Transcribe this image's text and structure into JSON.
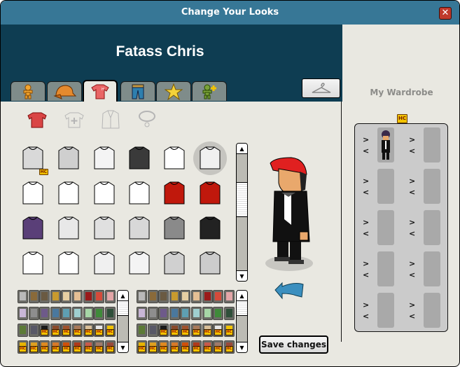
{
  "window": {
    "title": "Change Your Looks",
    "close_icon": "close-icon"
  },
  "header": {
    "username": "Fatass Chris"
  },
  "tabs": [
    {
      "name": "body",
      "icon": "body-figure-icon",
      "active": false
    },
    {
      "name": "head",
      "icon": "cap-icon",
      "active": false
    },
    {
      "name": "tops",
      "icon": "tshirt-icon",
      "active": true
    },
    {
      "name": "bottoms",
      "icon": "trousers-icon",
      "active": false
    },
    {
      "name": "extras",
      "icon": "star-icon",
      "active": false
    },
    {
      "name": "effects",
      "icon": "figure-plus-icon",
      "active": false
    }
  ],
  "wardrobe_button": {
    "icon": "hanger-icon"
  },
  "subcategories": [
    {
      "name": "shirts",
      "icon": "shirt-icon",
      "active": true
    },
    {
      "name": "prints",
      "icon": "shirt-print-icon",
      "active": false
    },
    {
      "name": "jackets",
      "icon": "jacket-icon",
      "active": false
    },
    {
      "name": "accessories",
      "icon": "necklace-icon",
      "active": false
    }
  ],
  "items": [
    {
      "id": "crop-top-stripe",
      "color": "#d9d9d9",
      "hc": true,
      "selected": false
    },
    {
      "id": "open-vest-gray",
      "color": "#cfcfcf",
      "hc": false,
      "selected": false
    },
    {
      "id": "button-blouse",
      "color": "#f4f4f4",
      "hc": false,
      "selected": false
    },
    {
      "id": "polka-dot-dress",
      "color": "#3a3a3a",
      "hc": false,
      "selected": false
    },
    {
      "id": "tank-ruffle",
      "color": "#ffffff",
      "hc": false,
      "selected": false
    },
    {
      "id": "tuxedo-shirt",
      "color": "#f0f0f0",
      "hc": false,
      "selected": true
    },
    {
      "id": "plain-tee",
      "color": "#ffffff",
      "hc": false,
      "selected": false
    },
    {
      "id": "raglan-print-1",
      "color": "#ffffff",
      "hc": false,
      "selected": false
    },
    {
      "id": "raglan-sheep",
      "color": "#ffffff",
      "hc": false,
      "selected": false
    },
    {
      "id": "raglan-print-2",
      "color": "#ffffff",
      "hc": false,
      "selected": false
    },
    {
      "id": "santa-jacket",
      "color": "#c0180c",
      "hc": false,
      "selected": false
    },
    {
      "id": "santa-dress",
      "color": "#c0180c",
      "hc": false,
      "selected": false
    },
    {
      "id": "robe-purple",
      "color": "#5a3f78",
      "hc": false,
      "selected": false
    },
    {
      "id": "striped-tee",
      "color": "#e8e8e8",
      "hc": false,
      "selected": false
    },
    {
      "id": "black-panel-shirt",
      "color": "#e0e0e0",
      "hc": false,
      "selected": false
    },
    {
      "id": "lace-top",
      "color": "#d8d8d8",
      "hc": false,
      "selected": false
    },
    {
      "id": "leopard-cami",
      "color": "#8a8a8a",
      "hc": false,
      "selected": false
    },
    {
      "id": "striped-bandeau",
      "color": "#222222",
      "hc": false,
      "selected": false
    },
    {
      "id": "wrap-sweater",
      "color": "#ffffff",
      "hc": false,
      "selected": false
    },
    {
      "id": "argyle-sweater",
      "color": "#ffffff",
      "hc": false,
      "selected": false
    },
    {
      "id": "check-sweater",
      "color": "#f0f0f0",
      "hc": false,
      "selected": false
    },
    {
      "id": "scoop-top",
      "color": "#f4f4f4",
      "hc": false,
      "selected": false
    },
    {
      "id": "cardigan-open",
      "color": "#d0d0d0",
      "hc": false,
      "selected": false
    },
    {
      "id": "bikini-top",
      "color": "#cccccc",
      "hc": false,
      "selected": false
    }
  ],
  "palette_primary": {
    "swatches": [
      {
        "color": "#b9b9b9",
        "hc": false
      },
      {
        "color": "#8a6a3a",
        "hc": false
      },
      {
        "color": "#6a5a42",
        "hc": false
      },
      {
        "color": "#c89a2e",
        "hc": false
      },
      {
        "color": "#e6cfa2",
        "hc": false
      },
      {
        "color": "#e5bf94",
        "hc": false
      },
      {
        "color": "#9a1a1a",
        "hc": false
      },
      {
        "color": "#d44a3a",
        "hc": false
      },
      {
        "color": "#e3a6a8",
        "hc": false
      },
      {
        "color": "#c8b6d6",
        "hc": false
      },
      {
        "color": "#8e8e8e",
        "hc": false
      },
      {
        "color": "#6e5a8a",
        "hc": false
      },
      {
        "color": "#4a789e",
        "hc": false
      },
      {
        "color": "#5e9fb2",
        "hc": false
      },
      {
        "color": "#9fcfd0",
        "hc": false
      },
      {
        "color": "#a7d6a7",
        "hc": false
      },
      {
        "color": "#3f8a3a",
        "hc": false
      },
      {
        "color": "#2f4f3a",
        "hc": false
      },
      {
        "color": "#5c7a36",
        "hc": false
      },
      {
        "color": "#585866",
        "hc": false
      },
      {
        "color": "#1a1a1a",
        "hc": true
      },
      {
        "color": "#8a4a2a",
        "hc": true
      },
      {
        "color": "#a0522d",
        "hc": true
      },
      {
        "color": "#a97a5a",
        "hc": true
      },
      {
        "color": "#d9c09a",
        "hc": true
      },
      {
        "color": "#e6e6e6",
        "hc": true
      },
      {
        "color": "#f2c300",
        "hc": true
      },
      {
        "color": "#e8b400",
        "hc": true
      },
      {
        "color": "#e0a020",
        "hc": true
      },
      {
        "color": "#e08a20",
        "hc": true
      },
      {
        "color": "#d87a2a",
        "hc": true
      },
      {
        "color": "#d0500a",
        "hc": true
      },
      {
        "color": "#b03a1a",
        "hc": true
      },
      {
        "color": "#c85a4a",
        "hc": true
      },
      {
        "color": "#a07a6a",
        "hc": true
      },
      {
        "color": "#9a4a3a",
        "hc": true
      }
    ]
  },
  "palette_secondary": {
    "swatches": [
      {
        "color": "#b9b9b9",
        "hc": false
      },
      {
        "color": "#8a6a3a",
        "hc": false
      },
      {
        "color": "#6a5a42",
        "hc": false
      },
      {
        "color": "#c89a2e",
        "hc": false
      },
      {
        "color": "#e6cfa2",
        "hc": false
      },
      {
        "color": "#e5bf94",
        "hc": false
      },
      {
        "color": "#9a1a1a",
        "hc": false
      },
      {
        "color": "#d44a3a",
        "hc": false
      },
      {
        "color": "#e3a6a8",
        "hc": false
      },
      {
        "color": "#c8b6d6",
        "hc": false
      },
      {
        "color": "#8e8e8e",
        "hc": false
      },
      {
        "color": "#6e5a8a",
        "hc": false
      },
      {
        "color": "#4a789e",
        "hc": false
      },
      {
        "color": "#5e9fb2",
        "hc": false
      },
      {
        "color": "#9fcfd0",
        "hc": false
      },
      {
        "color": "#a7d6a7",
        "hc": false
      },
      {
        "color": "#3f8a3a",
        "hc": false
      },
      {
        "color": "#2f4f3a",
        "hc": false
      },
      {
        "color": "#5c7a36",
        "hc": false
      },
      {
        "color": "#585866",
        "hc": false
      },
      {
        "color": "#1a1a1a",
        "hc": true
      },
      {
        "color": "#8a4a2a",
        "hc": true
      },
      {
        "color": "#a0522d",
        "hc": true
      },
      {
        "color": "#a97a5a",
        "hc": true
      },
      {
        "color": "#d9c09a",
        "hc": true
      },
      {
        "color": "#e6e6e6",
        "hc": true
      },
      {
        "color": "#f2c300",
        "hc": true
      },
      {
        "color": "#e8b400",
        "hc": true
      },
      {
        "color": "#e0a020",
        "hc": true
      },
      {
        "color": "#e08a20",
        "hc": true
      },
      {
        "color": "#d87a2a",
        "hc": true
      },
      {
        "color": "#d0500a",
        "hc": true
      },
      {
        "color": "#b03a1a",
        "hc": true
      },
      {
        "color": "#c85a4a",
        "hc": true
      },
      {
        "color": "#a07a6a",
        "hc": true
      },
      {
        "color": "#9a4a3a",
        "hc": true
      }
    ]
  },
  "hc_badge_label": "HC",
  "preview": {
    "rotate_icon": "rotate-arrow-icon"
  },
  "save_button": {
    "label": "Save changes"
  },
  "wardrobe": {
    "title": "My Wardrobe",
    "hc_icon": "hc-badge-icon",
    "save_arrow": ">",
    "load_arrow": "<",
    "slots": [
      {
        "filled": true
      },
      {
        "filled": false
      },
      {
        "filled": false
      },
      {
        "filled": false
      },
      {
        "filled": false
      },
      {
        "filled": false
      },
      {
        "filled": false
      },
      {
        "filled": false
      },
      {
        "filled": false
      },
      {
        "filled": false
      }
    ]
  },
  "colors": {
    "titlebar": "#377796",
    "header": "#0e3d52",
    "body": "#e9e8e1",
    "close": "#c0392b",
    "wardrobe_panel": "#cbcbcb",
    "wardrobe_slot": "#a9a9a9"
  }
}
